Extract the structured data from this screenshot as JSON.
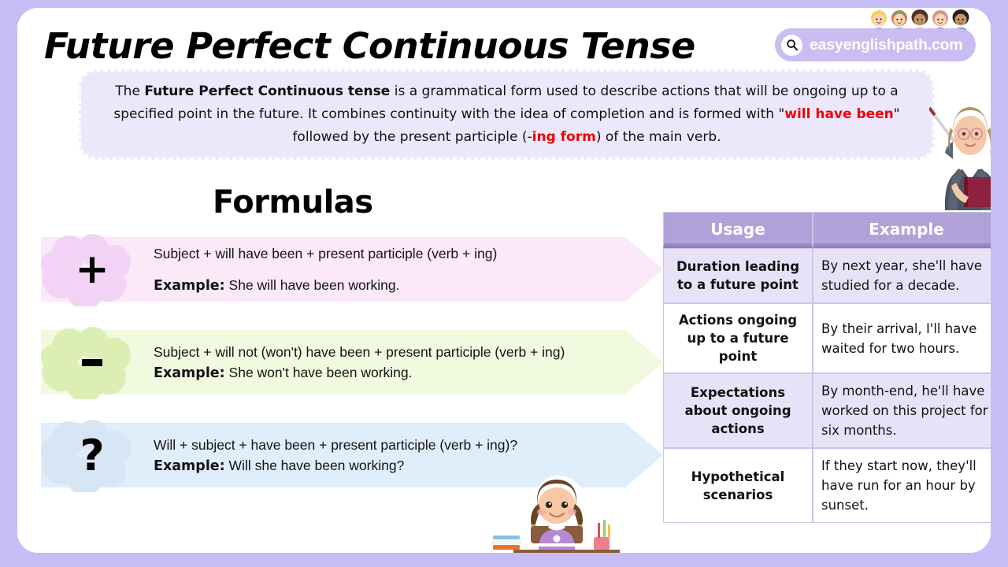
{
  "header": {
    "title": "Future Perfect Continuous Tense",
    "brand": "easyenglishpath.com",
    "search_icon": "search-icon"
  },
  "description": {
    "part1": "The ",
    "bold1": "Future Perfect Continuous tense",
    "part2": " is a grammatical form used to describe actions that will be ongoing up to a specified point in the future. It combines continuity with the idea of completion and is formed with \"",
    "red1": "will have been",
    "part3": "\" followed by the present participle (-",
    "red2": "ing form",
    "part4": ") of the main verb."
  },
  "formulas": {
    "heading": "Formulas",
    "rows": [
      {
        "symbol": "+",
        "name": "positive",
        "structure": "Subject + will have been + present participle (verb + ing)",
        "example_label": "Example:",
        "example_text": " She will have been working.",
        "bg": "#fbe8f8",
        "blob": "#f2d3f5"
      },
      {
        "symbol": "‒",
        "name": "negative",
        "structure": "Subject + will not (won't) have been + present participle (verb + ing)",
        "example_label": "Example:",
        "example_text": " She won't have been working.",
        "bg": "#f1f9df",
        "blob": "#ddeeb4"
      },
      {
        "symbol": "?",
        "name": "question",
        "structure": "Will + subject + have been + present participle (verb + ing)?",
        "example_label": "Example:",
        "example_text": " Will she have been working?",
        "bg": "#e0edfa",
        "blob": "#d6e6f5"
      }
    ]
  },
  "table": {
    "headers": [
      "Usage",
      "Example"
    ],
    "rows": [
      {
        "usage": "Duration leading to a future point",
        "example": "By next year, she'll have studied for a decade."
      },
      {
        "usage": "Actions ongoing up to a future point",
        "example": "By their arrival, I'll have waited for two hours."
      },
      {
        "usage": "Expectations about ongoing actions",
        "example": "By month-end, he'll have worked on this project for six months."
      },
      {
        "usage": "Hypothetical scenarios",
        "example": "If they start now, they'll have run for an hour by sunset."
      }
    ]
  },
  "colors": {
    "page_border": "#c6bdf7",
    "card": "#ffffff",
    "brand_pill": "#c9bdf2",
    "desc_bg": "#ece7fb",
    "accent_red": "#ee0000",
    "table_header": "#b0a2d8",
    "table_alt_row": "#e8e2f8"
  },
  "illustrations": {
    "kids": "kids-group-illustration",
    "teacher": "teacher-with-pointer-illustration",
    "girl": "girl-studying-at-desk-illustration"
  }
}
